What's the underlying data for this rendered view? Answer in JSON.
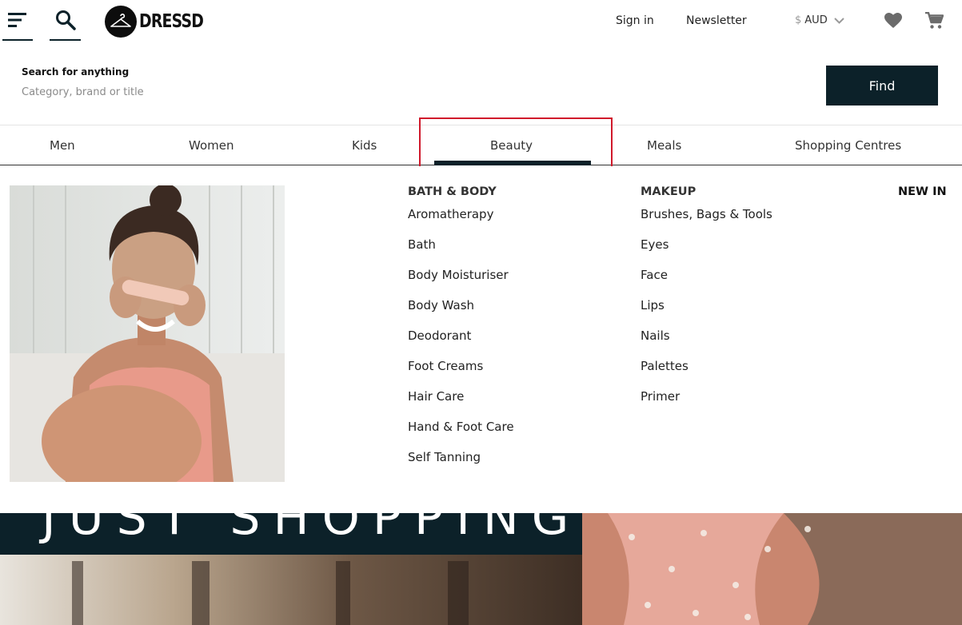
{
  "header": {
    "logo_text": "DRESSD",
    "sign_in": "Sign in",
    "newsletter": "Newsletter",
    "currency_symbol": "$",
    "currency_code": "AUD",
    "icons": [
      "menu-icon",
      "search-icon",
      "hanger-icon",
      "chevron-down-icon",
      "heart-icon",
      "cart-icon"
    ]
  },
  "search": {
    "label": "Search for anything",
    "placeholder": "Category, brand or title",
    "value": "",
    "button": "Find"
  },
  "nav": {
    "tabs": [
      {
        "label": "Men"
      },
      {
        "label": "Women"
      },
      {
        "label": "Kids"
      },
      {
        "label": "Beauty",
        "active": true
      },
      {
        "label": "Meals"
      },
      {
        "label": "Shopping Centres"
      }
    ]
  },
  "mega_menu": {
    "bath_body": {
      "heading": "BATH & BODY",
      "items": [
        "Aromatherapy",
        "Bath",
        "Body Moisturiser",
        "Body Wash",
        "Deodorant",
        "Foot Creams",
        "Hair Care",
        "Hand & Foot Care",
        "Self Tanning"
      ]
    },
    "makeup": {
      "heading": "MAKEUP",
      "items": [
        "Brushes, Bags & Tools",
        "Eyes",
        "Face",
        "Lips",
        "Nails",
        "Palettes",
        "Primer"
      ]
    },
    "new_in": "NEW IN"
  },
  "hero": {
    "banner_text": "JUST SHOPPING"
  },
  "colors": {
    "primary_dark": "#0c2129",
    "highlight_red": "#d0192b",
    "text": "#222222",
    "muted": "#8a8a8a"
  }
}
